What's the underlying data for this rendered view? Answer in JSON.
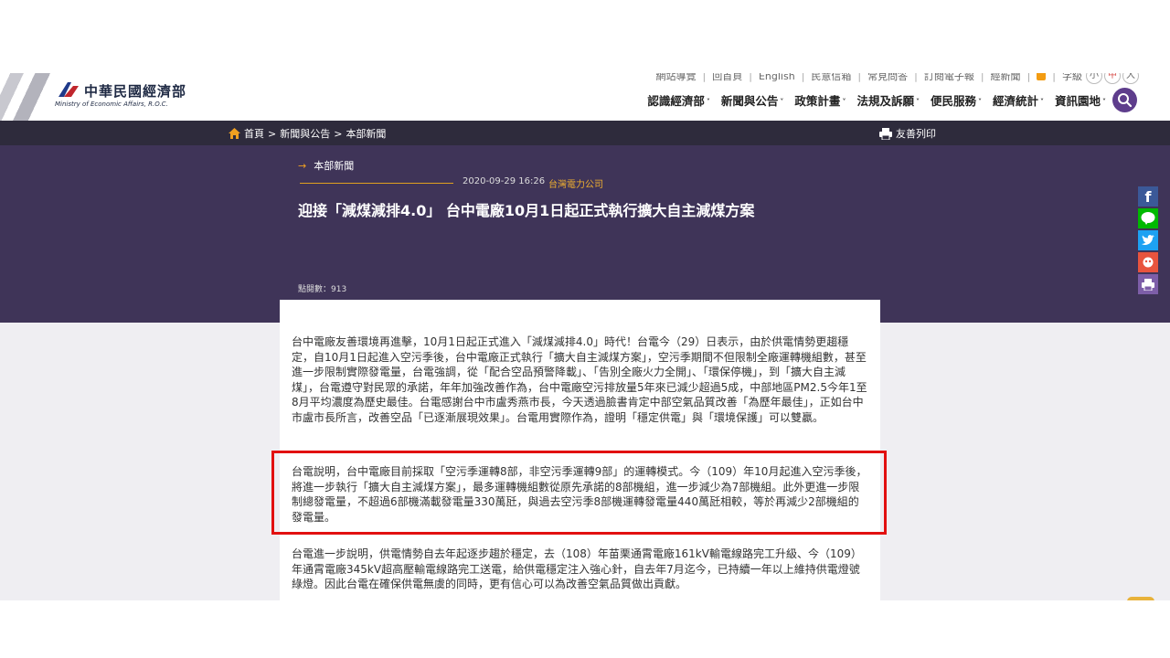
{
  "brand": {
    "name_zh": "中華民國經濟部",
    "name_en": "Ministry of Economic Affairs, R.O.C."
  },
  "util_links": [
    "網站導覽",
    "回首頁",
    "English",
    "民意信箱",
    "常見問答",
    "訂閱電子報",
    "經新聞"
  ],
  "font_size": {
    "label": "字級",
    "small": "小",
    "medium": "中",
    "large": "大"
  },
  "nav": [
    "認識經濟部",
    "新聞與公告",
    "政策計畫",
    "法規及訴願",
    "便民服務",
    "經濟統計",
    "資訊園地"
  ],
  "breadcrumb": [
    "首頁",
    "新聞與公告",
    "本部新聞"
  ],
  "print_label": "友善列印",
  "article": {
    "section": "本部新聞",
    "date": "2020-09-29 16:26",
    "org": "台灣電力公司",
    "title": "迎接「減煤減排4.0」 台中電廠10月1日起正式執行擴大自主減煤方案",
    "hits": "點閱數：913",
    "paragraphs": [
      "台中電廠友善環境再進擊，10月1日起正式進入「減煤減排4.0」時代！台電今（29）日表示，由於供電情勢更趨穩定，自10月1日起進入空污季後，台中電廠正式執行「擴大自主減煤方案」，空污季期間不但限制全廠運轉機組數，甚至進一步限制實際發電量，台電強調，從「配合空品預警降載」、「告別全廠火力全開」、「環保停機」，到「擴大自主減煤」，台電遵守對民眾的承諾，年年加強改善作為，台中電廠空污排放量5年來已減少超過5成，中部地區PM2.5今年1至8月平均濃度為歷史最佳。台電感謝台中市盧秀燕市長，今天透過臉書肯定中部空氣品質改善「為歷年最佳」，正如台中市盧市長所言，改善空品「已逐漸展現效果」。台電用實際作為，證明「穩定供電」與「環境保護」可以雙贏。",
      "台電說明，台中電廠目前採取「空污季運轉8部，非空污季運轉9部」的運轉模式。今（109）年10月起進入空污季後，將進一步執行「擴大自主減煤方案」，最多運轉機組數從原先承諾的8部機組，進一步減少為7部機組。此外更進一步限制總發電量，不超過6部機滿載發電量330萬瓩，與過去空污季8部機運轉發電量440萬瓩相較，等於再減少2部機組的發電量。",
      "台電進一步說明，供電情勢自去年起逐步趨於穩定，去（108）年苗栗通霄電廠161kV輸電線路完工升級、今（109）年通霄電廠345kV超高壓輸電線路完工送電，給供電穩定注入強心針，自去年7月迄今，已持續一年以上維持供電燈號綠燈。因此台電在確保供電無虞的同時，更有信心可以為改善空氣品質做出貢獻。"
    ]
  },
  "share_icons": [
    "facebook-icon",
    "line-icon",
    "twitter-icon",
    "plurk-icon",
    "print-icon"
  ],
  "colors": {
    "hero": "#3f3458",
    "crumb_bar": "#2e2b3c",
    "accent": "#5e3d8c",
    "highlight": "#e21010",
    "gold": "#f0a020"
  }
}
